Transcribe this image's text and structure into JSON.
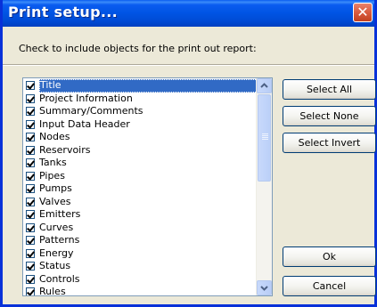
{
  "window": {
    "title": "Print setup...",
    "close_glyph": "✕"
  },
  "instructions": "Check to include objects for the print out report:",
  "objects": [
    {
      "label": "Title",
      "checked": true,
      "selected": true
    },
    {
      "label": "Project Information",
      "checked": true
    },
    {
      "label": "Summary/Comments",
      "checked": true
    },
    {
      "label": "Input Data Header",
      "checked": true
    },
    {
      "label": "Nodes",
      "checked": true
    },
    {
      "label": "Reservoirs",
      "checked": true
    },
    {
      "label": "Tanks",
      "checked": true
    },
    {
      "label": "Pipes",
      "checked": true
    },
    {
      "label": "Pumps",
      "checked": true
    },
    {
      "label": "Valves",
      "checked": true
    },
    {
      "label": "Emitters",
      "checked": true
    },
    {
      "label": "Curves",
      "checked": true
    },
    {
      "label": "Patterns",
      "checked": true
    },
    {
      "label": "Energy",
      "checked": true
    },
    {
      "label": "Status",
      "checked": true
    },
    {
      "label": "Controls",
      "checked": true
    },
    {
      "label": "Rules",
      "checked": true
    }
  ],
  "buttons": {
    "select_all": "Select All",
    "select_none": "Select None",
    "select_invert": "Select Invert",
    "ok": "Ok",
    "cancel": "Cancel"
  },
  "colors": {
    "titlebar": "#0054e3",
    "selection": "#316ac5",
    "dialog_bg": "#ece9d8",
    "close_button": "#d95b3f"
  }
}
